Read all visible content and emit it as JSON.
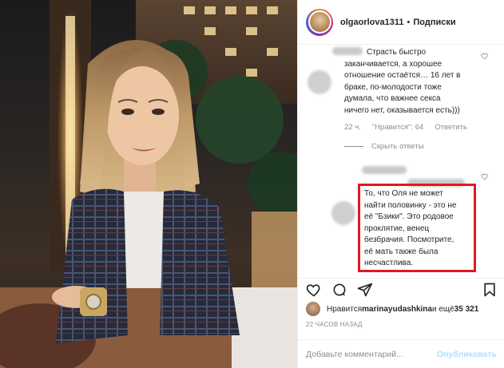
{
  "post": {
    "username": "olgaorlova1311",
    "separator": "•",
    "follow_label": "Подписки"
  },
  "comments": [
    {
      "text_lines": [
        "Страсть быстро",
        "заканчивается, а хорошее",
        "отношение остаётся… 16 лет в",
        "браке, по-молодости тоже",
        "думала, что важнее секса",
        "ничего нет, оказывается есть)))"
      ],
      "time": "22 ч.",
      "likes": "\"Нравится\": 64",
      "reply_label": "Ответить",
      "hide_replies_label": "Скрыть ответы"
    },
    {
      "text_lines": [
        "То, что Оля не может",
        "найти половинку - это не",
        "её \"Бзики\". Это родовое",
        "проклятие, венец",
        "безбрачия. Посмотрите,",
        "её мать также была",
        "несчастлива."
      ],
      "highlight_color": "#e2181d"
    }
  ],
  "likes_row": {
    "prefix": "Нравится ",
    "user": "marinayudashkina",
    "suffix": " и ещё ",
    "count": "35 321"
  },
  "timestamp": "22 ЧАСОВ НАЗАД",
  "add_comment": {
    "placeholder": "Добавьте комментарий...",
    "publish_label": "Опубликовать"
  },
  "colors": {
    "accent": "#0095f6",
    "publish_disabled": "#b2dffc",
    "highlight_box": "#e2181d"
  },
  "icons": [
    "heart-icon",
    "comment-icon",
    "share-icon",
    "bookmark-icon"
  ]
}
